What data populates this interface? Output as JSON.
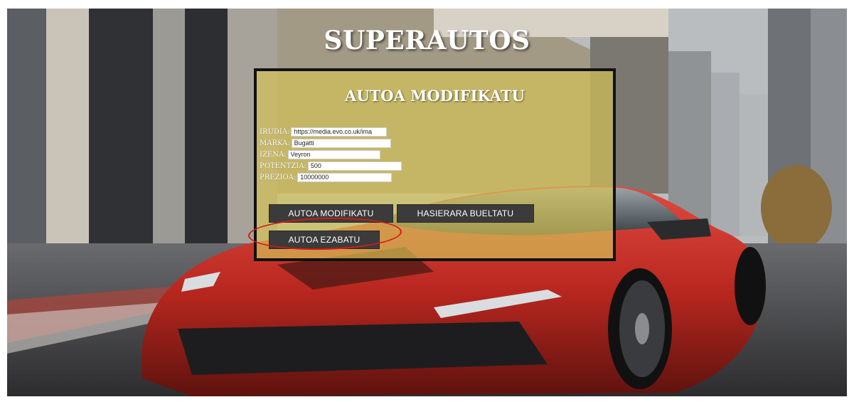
{
  "site": {
    "title": "SUPERAUTOS"
  },
  "panel": {
    "title": "AUTOA MODIFIKATU"
  },
  "form": {
    "fields": [
      {
        "label": "IRUDIA:",
        "value": "https://media.evo.co.uk/ima"
      },
      {
        "label": "MARKA:",
        "value": "Bugatti"
      },
      {
        "label": "IZENA:",
        "value": "Veyron"
      },
      {
        "label": "POTENTZIA:",
        "value": "500"
      },
      {
        "label": "PREZIOA:",
        "value": "10000000"
      }
    ]
  },
  "buttons": {
    "modify": "AUTOA MODIFIKATU",
    "home": "HASIERARA BUELTATU",
    "delete": "AUTOA EZABATU"
  },
  "colors": {
    "panel_bg": "#d6c456",
    "button_bg": "#3b3b3b",
    "highlight": "#d21a1a",
    "car": "#c8322b"
  }
}
